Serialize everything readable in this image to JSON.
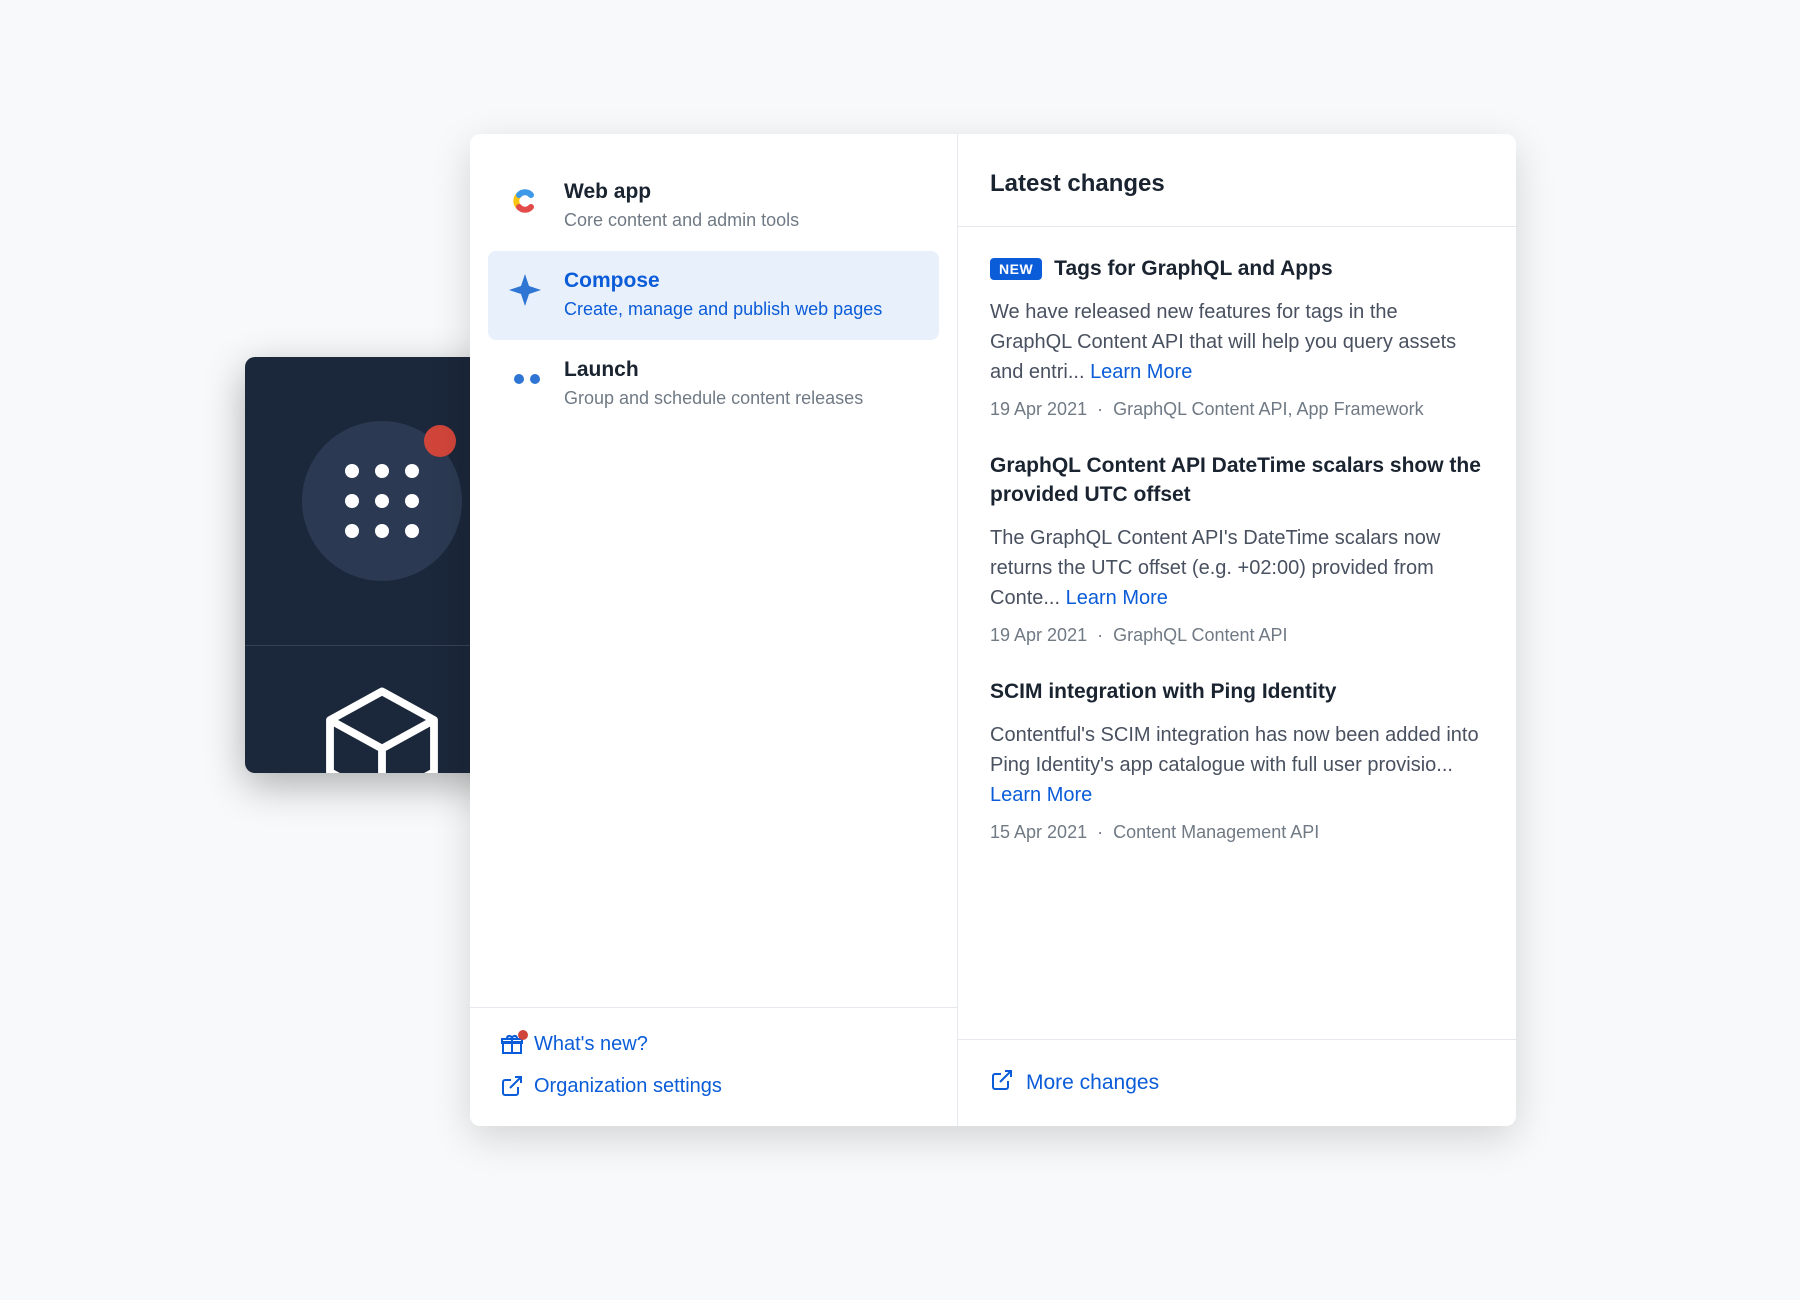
{
  "apps": [
    {
      "title": "Web app",
      "desc": "Core content and admin tools",
      "icon": "contentful"
    },
    {
      "title": "Compose",
      "desc": "Create, manage and publish web pages",
      "icon": "compose"
    },
    {
      "title": "Launch",
      "desc": "Group and schedule content releases",
      "icon": "launch"
    }
  ],
  "footer_left": {
    "whats_new": "What's new?",
    "org_settings": "Organization settings"
  },
  "right": {
    "header": "Latest changes",
    "new_label": "NEW",
    "learn_more": "Learn More",
    "more_changes": "More changes",
    "changes": [
      {
        "title": "Tags for GraphQL and Apps",
        "desc": "We have released new features for tags in the GraphQL Content API that will help you query assets and entri... ",
        "date": "19 Apr 2021",
        "tags": "GraphQL Content API, App Framework",
        "is_new": true
      },
      {
        "title": "GraphQL Content API DateTime scalars show the provided UTC offset",
        "desc": "The GraphQL Content API's DateTime scalars now returns the UTC offset (e.g. +02:00) provided from Conte... ",
        "date": "19 Apr 2021",
        "tags": "GraphQL Content API",
        "is_new": false
      },
      {
        "title": "SCIM integration with Ping Identity",
        "desc": "Contentful's SCIM integration has now been added into Ping Identity's app catalogue with full user provisio... ",
        "date": "15 Apr 2021",
        "tags": "Content Management API",
        "is_new": false
      }
    ]
  }
}
